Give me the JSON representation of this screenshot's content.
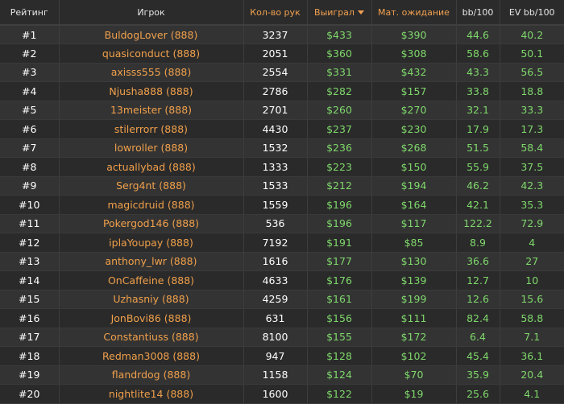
{
  "table": {
    "headers": {
      "rank": "Рейтинг",
      "player": "Игрок",
      "hands": "Кол-во рук",
      "won": "Выиграл",
      "ev": "Мат. ожидание",
      "bb100": "bb/100",
      "evbb100": "EV bb/100"
    },
    "rows": [
      {
        "rank": "#1",
        "player": "BuldogLover (888)",
        "hands": "3237",
        "won": "$433",
        "ev": "$390",
        "bb100": "44.6",
        "evbb100": "40.2"
      },
      {
        "rank": "#2",
        "player": "quasiconduct (888)",
        "hands": "2051",
        "won": "$360",
        "ev": "$308",
        "bb100": "58.6",
        "evbb100": "50.1"
      },
      {
        "rank": "#3",
        "player": "axisss555 (888)",
        "hands": "2554",
        "won": "$331",
        "ev": "$432",
        "bb100": "43.3",
        "evbb100": "56.5"
      },
      {
        "rank": "#4",
        "player": "Njusha888 (888)",
        "hands": "2786",
        "won": "$282",
        "ev": "$157",
        "bb100": "33.8",
        "evbb100": "18.8"
      },
      {
        "rank": "#5",
        "player": "13meister (888)",
        "hands": "2701",
        "won": "$260",
        "ev": "$270",
        "bb100": "32.1",
        "evbb100": "33.3"
      },
      {
        "rank": "#6",
        "player": "stilerrorr (888)",
        "hands": "4430",
        "won": "$237",
        "ev": "$230",
        "bb100": "17.9",
        "evbb100": "17.3"
      },
      {
        "rank": "#7",
        "player": "lowroller (888)",
        "hands": "1532",
        "won": "$236",
        "ev": "$268",
        "bb100": "51.5",
        "evbb100": "58.4"
      },
      {
        "rank": "#8",
        "player": "actuallybad (888)",
        "hands": "1333",
        "won": "$223",
        "ev": "$150",
        "bb100": "55.9",
        "evbb100": "37.5"
      },
      {
        "rank": "#9",
        "player": "Serg4nt (888)",
        "hands": "1533",
        "won": "$212",
        "ev": "$194",
        "bb100": "46.2",
        "evbb100": "42.3"
      },
      {
        "rank": "#10",
        "player": "magicdruid (888)",
        "hands": "1559",
        "won": "$196",
        "ev": "$164",
        "bb100": "42.1",
        "evbb100": "35.3"
      },
      {
        "rank": "#11",
        "player": "Pokergod146 (888)",
        "hands": "536",
        "won": "$196",
        "ev": "$117",
        "bb100": "122.2",
        "evbb100": "72.9"
      },
      {
        "rank": "#12",
        "player": "iplaYoupay (888)",
        "hands": "7192",
        "won": "$191",
        "ev": "$85",
        "bb100": "8.9",
        "evbb100": "4"
      },
      {
        "rank": "#13",
        "player": "anthony_lwr (888)",
        "hands": "1616",
        "won": "$177",
        "ev": "$130",
        "bb100": "36.6",
        "evbb100": "27"
      },
      {
        "rank": "#14",
        "player": "OnCaffeine (888)",
        "hands": "4633",
        "won": "$176",
        "ev": "$139",
        "bb100": "12.7",
        "evbb100": "10"
      },
      {
        "rank": "#15",
        "player": "Uzhasniy (888)",
        "hands": "4259",
        "won": "$161",
        "ev": "$199",
        "bb100": "12.6",
        "evbb100": "15.6"
      },
      {
        "rank": "#16",
        "player": "JonBovi86 (888)",
        "hands": "631",
        "won": "$156",
        "ev": "$111",
        "bb100": "82.4",
        "evbb100": "58.8"
      },
      {
        "rank": "#17",
        "player": "Constantiuss (888)",
        "hands": "8100",
        "won": "$155",
        "ev": "$172",
        "bb100": "6.4",
        "evbb100": "7.1"
      },
      {
        "rank": "#18",
        "player": "Redman3008 (888)",
        "hands": "947",
        "won": "$128",
        "ev": "$102",
        "bb100": "45.4",
        "evbb100": "36.1"
      },
      {
        "rank": "#19",
        "player": "flandrdog (888)",
        "hands": "1158",
        "won": "$124",
        "ev": "$70",
        "bb100": "35.9",
        "evbb100": "20.4"
      },
      {
        "rank": "#20",
        "player": "nightlite14 (888)",
        "hands": "1600",
        "won": "$122",
        "ev": "$19",
        "bb100": "25.6",
        "evbb100": "4.1"
      }
    ]
  },
  "colors": {
    "background": "#2b2b2b",
    "row_odd": "#333333",
    "row_even": "#2a2a2a",
    "player_name": "#f0a04b",
    "positive_value": "#7fd86b",
    "header_highlight": "#f0a050"
  },
  "icons": {
    "sort_indicator": "sort-desc-icon"
  }
}
